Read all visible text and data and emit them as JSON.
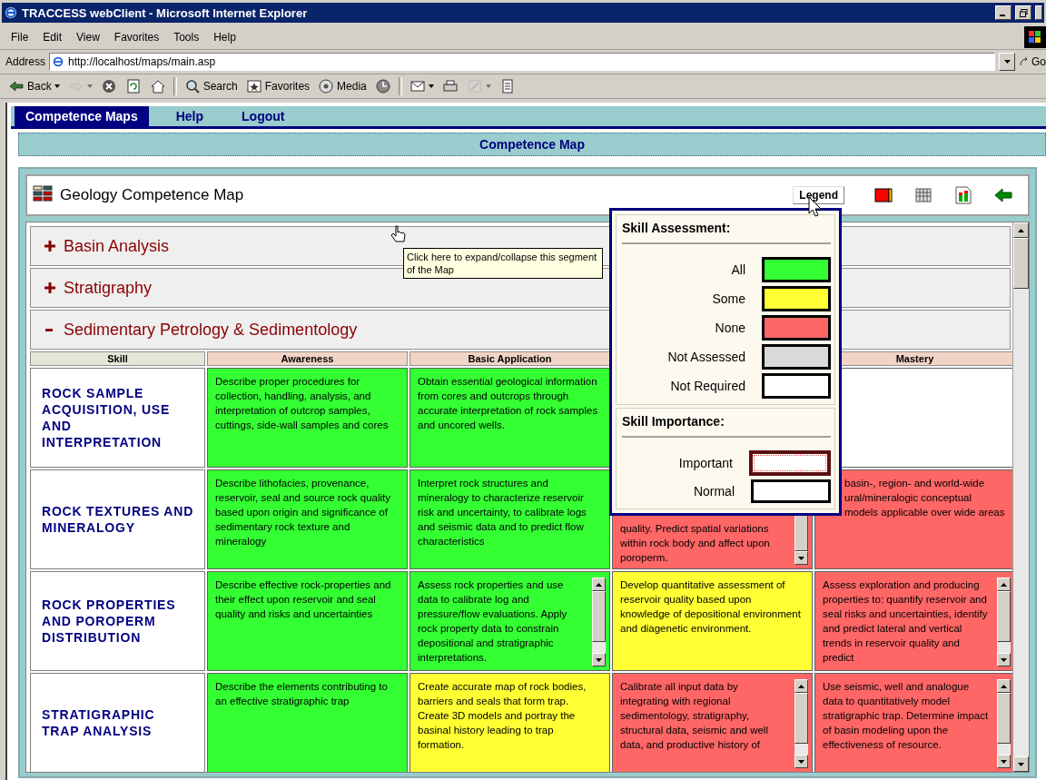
{
  "window": {
    "title": "TRACCESS webClient - Microsoft Internet Explorer"
  },
  "menu": [
    "File",
    "Edit",
    "View",
    "Favorites",
    "Tools",
    "Help"
  ],
  "address": {
    "label": "Address",
    "value": "http://localhost/maps/main.asp",
    "go": "Go"
  },
  "toolbar": [
    {
      "kind": "back",
      "label": "Back",
      "disabled": false
    },
    {
      "kind": "forward",
      "disabled": true
    },
    {
      "kind": "stop",
      "disabled": false
    },
    {
      "kind": "refresh",
      "disabled": false
    },
    {
      "kind": "home",
      "disabled": false
    },
    {
      "kind": "search",
      "label": "Search",
      "disabled": false
    },
    {
      "kind": "favorites",
      "label": "Favorites",
      "disabled": false
    },
    {
      "kind": "media",
      "label": "Media",
      "disabled": false
    },
    {
      "kind": "history",
      "disabled": false
    },
    {
      "kind": "mail",
      "disabled": false
    },
    {
      "kind": "print",
      "disabled": false
    },
    {
      "kind": "edit",
      "disabled": true
    },
    {
      "kind": "discuss",
      "disabled": false
    }
  ],
  "nav": [
    {
      "label": "Competence Maps",
      "selected": true
    },
    {
      "label": "Help",
      "selected": false
    },
    {
      "label": "Logout",
      "selected": false
    }
  ],
  "page_header": "Competence Map",
  "map": {
    "title": "Geology Competence Map",
    "legend_button": "Legend",
    "tools": [
      {
        "kind": "assessment"
      },
      {
        "kind": "grid"
      },
      {
        "kind": "chart"
      },
      {
        "kind": "back"
      }
    ]
  },
  "segments": [
    {
      "label": "Basin Analysis",
      "expanded": false
    },
    {
      "label": "Stratigraphy",
      "expanded": false
    },
    {
      "label": "Sedimentary Petrology & Sedimentology",
      "expanded": true
    }
  ],
  "tooltip": "Click here to expand/collapse this segment of the Map",
  "table": {
    "columns": [
      "Skill",
      "Awareness",
      "Basic Application",
      "",
      "Mastery"
    ],
    "rows": [
      {
        "cells": [
          {
            "kind": "skill",
            "text": "ROCK SAMPLE ACQUISITION, USE AND INTERPRETATION"
          },
          {
            "kind": "level",
            "color": "#33ff33",
            "text": "Describe proper procedures for collection, handling, analysis, and interpretation of outcrop samples, cuttings, side-wall samples and cores"
          },
          {
            "kind": "level",
            "color": "#33ff33",
            "text": "Obtain essential geological information from cores and outcrops through accurate interpretation of rock samples and uncored wells."
          },
          {},
          {
            "kind": "level",
            "color": "#ffffff"
          }
        ]
      },
      {
        "cells": [
          {
            "kind": "skill",
            "text": "ROCK TEXTURES AND MINERALOGY"
          },
          {
            "kind": "level",
            "color": "#33ff33",
            "text": "Describe lithofacies, provenance, reservoir, seal and source rock quality based upon origin and significance of sedimentary rock texture and mineralogy"
          },
          {
            "kind": "level",
            "color": "#33ff33",
            "text": "Interpret rock structures and mineralogy to characterize reservoir risk and uncertainty, to calibrate logs and seismic data and to predict flow characteristics"
          },
          {
            "kind": "level",
            "color": "#ff6666",
            "text": "quality.  Predict spatial variations within rock body and affect upon poroperm.",
            "scroll": true,
            "scrolled": true
          },
          {
            "kind": "level",
            "color": "#ff6666",
            "text": "basin-, region- and world-wide ural/mineralogic conceptual models applicable over wide areas"
          }
        ]
      },
      {
        "cells": [
          {
            "kind": "skill",
            "text": "ROCK PROPERTIES AND POROPERM DISTRIBUTION"
          },
          {
            "kind": "level",
            "color": "#33ff33",
            "text": "Describe effective rock-properties and their effect upon reservoir and seal quality and risks and uncertainties"
          },
          {
            "kind": "level",
            "color": "#33ff33",
            "text": "Assess rock properties and use data to calibrate log and pressure/flow evaluations.  Apply rock property data to constrain depositional and stratigraphic interpretations.",
            "scroll": true,
            "scrolled": false
          },
          {
            "kind": "level",
            "color": "#ffff33",
            "text": "Develop quantitative assessment of reservoir quality based upon knowledge of depositional environment and diagenetic environment."
          },
          {
            "kind": "level",
            "color": "#ff6666",
            "text": "Assess exploration and producing properties to: quantify reservoir and seal risks and uncertainties, identify and predict lateral and vertical trends in reservoir quality and predict",
            "scroll": true,
            "scrolled": false
          }
        ]
      },
      {
        "cells": [
          {
            "kind": "skill",
            "text": "STRATIGRAPHIC TRAP ANALYSIS"
          },
          {
            "kind": "level",
            "color": "#33ff33",
            "text": "Describe the elements contributing to an effective stratigraphic trap"
          },
          {
            "kind": "level",
            "color": "#ffff33",
            "text": "Create accurate map of rock bodies, barriers and seals that form trap.  Create 3D models and portray the basinal history leading to trap formation."
          },
          {
            "kind": "level",
            "color": "#ff6666",
            "text": "Calibrate all input data by integrating with regional sedimentology, stratigraphy, structural data, seismic and well data, and productive history of",
            "scroll": true,
            "scrolled": false
          },
          {
            "kind": "level",
            "color": "#ff6666",
            "text": "Use seismic, well and analogue data to quantitatively model stratigraphic trap.  Determine impact of basin modeling upon the effectiveness of resource.",
            "scroll": true,
            "scrolled": false
          }
        ]
      }
    ]
  },
  "legend": {
    "assessment_title": "Skill Assessment:",
    "assessment": [
      {
        "label": "All",
        "color": "#33ff33"
      },
      {
        "label": "Some",
        "color": "#ffff33"
      },
      {
        "label": "None",
        "color": "#ff6666"
      },
      {
        "label": "Not Assessed",
        "color": "#d9d9d9"
      },
      {
        "label": "Not Required",
        "color": "#ffffff"
      }
    ],
    "importance_title": "Skill Importance:",
    "importance": [
      {
        "label": "Important",
        "kind": "important"
      },
      {
        "label": "Normal",
        "kind": "normal"
      }
    ]
  }
}
